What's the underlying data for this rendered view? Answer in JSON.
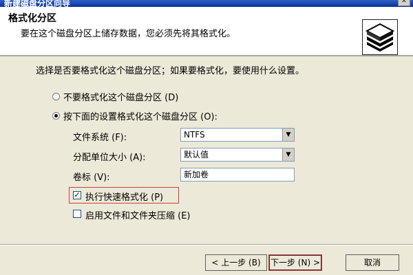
{
  "window": {
    "title": "新建磁盘分区向导",
    "close_glyph": "x"
  },
  "header": {
    "title": "格式化分区",
    "subtitle": "要在这个磁盘分区上储存数据，您必须先将其格式化。",
    "icon": "disk-stack-icon"
  },
  "instruction": "选择是否要格式化这个磁盘分区；如果要格式化，要使用什么设置。",
  "options": {
    "no_format": {
      "label": "不要格式化这个磁盘分区 (D)",
      "checked": false
    },
    "format": {
      "label": "按下面的设置格式化这个磁盘分区 (O):",
      "checked": true
    }
  },
  "fields": {
    "filesystem": {
      "label": "文件系统 (F):",
      "value": "NTFS"
    },
    "alloc_unit": {
      "label": "分配单位大小 (A):",
      "value": "默认值"
    },
    "volume_label": {
      "label": "卷标 (V):",
      "value": "新加卷"
    }
  },
  "checkboxes": {
    "quick_format": {
      "label": "执行快速格式化 (P)",
      "checked": true
    },
    "compression": {
      "label": "启用文件和文件夹压缩 (E)",
      "checked": false
    }
  },
  "buttons": {
    "back": "< 上一步 (B)",
    "next": "下一步 (N) >",
    "cancel": "取消"
  },
  "colors": {
    "highlight": "#d43a3a",
    "title_bar": "#0a2e9a"
  }
}
